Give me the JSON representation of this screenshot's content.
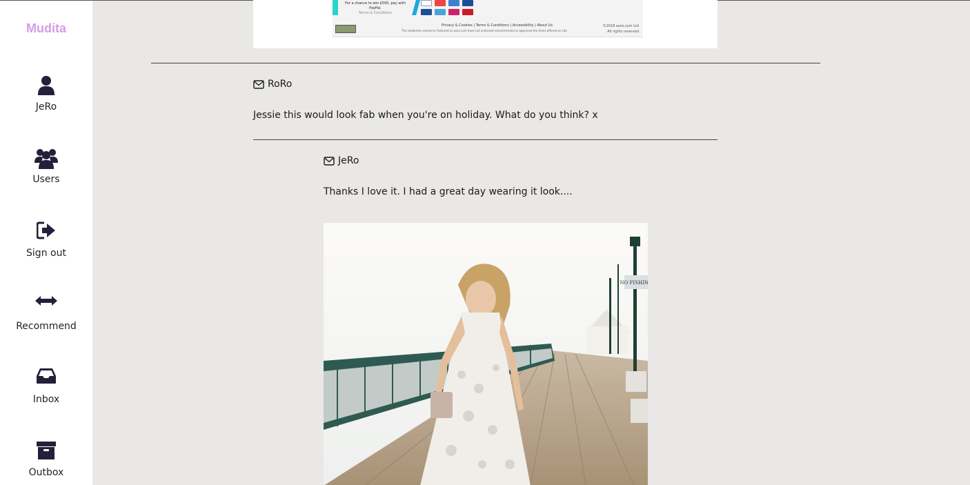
{
  "sidebar": {
    "brand": "Mudita",
    "items": [
      {
        "label": "JeRo",
        "icon": "user-icon"
      },
      {
        "label": "Users",
        "icon": "users-icon"
      },
      {
        "label": "Sign out",
        "icon": "sign-out-icon"
      },
      {
        "label": "Recommend",
        "icon": "arrows-horizontal-icon"
      },
      {
        "label": "Inbox",
        "icon": "inbox-icon"
      },
      {
        "label": "Outbox",
        "icon": "archive-icon"
      }
    ]
  },
  "colors": {
    "brand": "#d79be8",
    "icon": "#22203a",
    "background": "#e9e8e6",
    "sidebar": "#ffffff"
  },
  "top_image": {
    "promo": "For a chance to win £500, pay with PayPal.",
    "promo_sub": "Terms & Conditions",
    "links": "Privacy & Cookies | Terms & Conditions | Accessibility | About Us",
    "disclaimer": "The celebrities named or featured on asos.com have not endorsed recommended or approved the items offered on site",
    "copyright": "©2018 asos.com Ltd",
    "rights": "All rights reserved"
  },
  "thread": {
    "recommendation": {
      "author": "RoRo",
      "message": "Jessie this would look fab when you're on holiday. What do you think? x"
    },
    "reply": {
      "author": "JeRo",
      "message": "Thanks I love it. I had a great day wearing it look...."
    },
    "photo_sign": "NO FISHING"
  }
}
